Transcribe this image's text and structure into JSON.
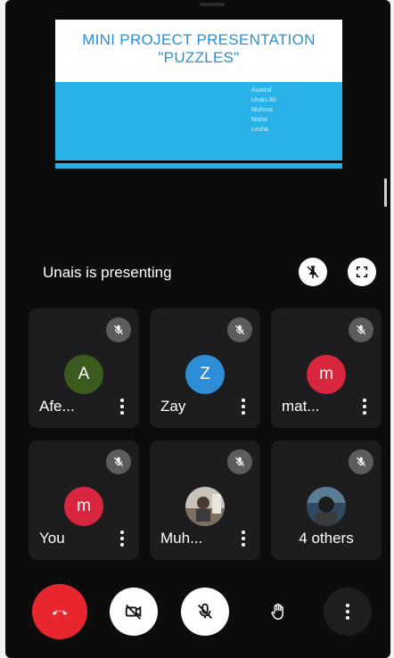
{
  "slide": {
    "title_line1": "MINI PROJECT PRESENTATION",
    "title_line2": "\"PUZZLES\"",
    "names": [
      "Aswind",
      "Unais Ali",
      "Nishma",
      "Nisha",
      "Lesha"
    ]
  },
  "presenting": {
    "text": "Unais is presenting",
    "pin_icon": "pin-off-icon",
    "fullscreen_icon": "fullscreen-icon"
  },
  "participants": [
    {
      "name": "Afe...",
      "initial": "A",
      "color": "#3a5a1e",
      "muted": true
    },
    {
      "name": "Zay",
      "initial": "Z",
      "color": "#2d8ed6",
      "muted": true
    },
    {
      "name": "mat...",
      "initial": "m",
      "color": "#d7263d",
      "muted": true
    },
    {
      "name": "You",
      "initial": "m",
      "color": "#d7263d",
      "muted": true
    },
    {
      "name": "Muh...",
      "initial": "",
      "color": "#8a7a6a",
      "muted": true
    },
    {
      "name": "4 others",
      "initial": "",
      "color": "#6a7a8a",
      "muted": true
    }
  ],
  "controls": {
    "hangup_color": "#e8262d",
    "icons": [
      "phone-hangup-icon",
      "camera-off-icon",
      "mic-off-icon",
      "raise-hand-icon",
      "more-vert-icon"
    ]
  }
}
